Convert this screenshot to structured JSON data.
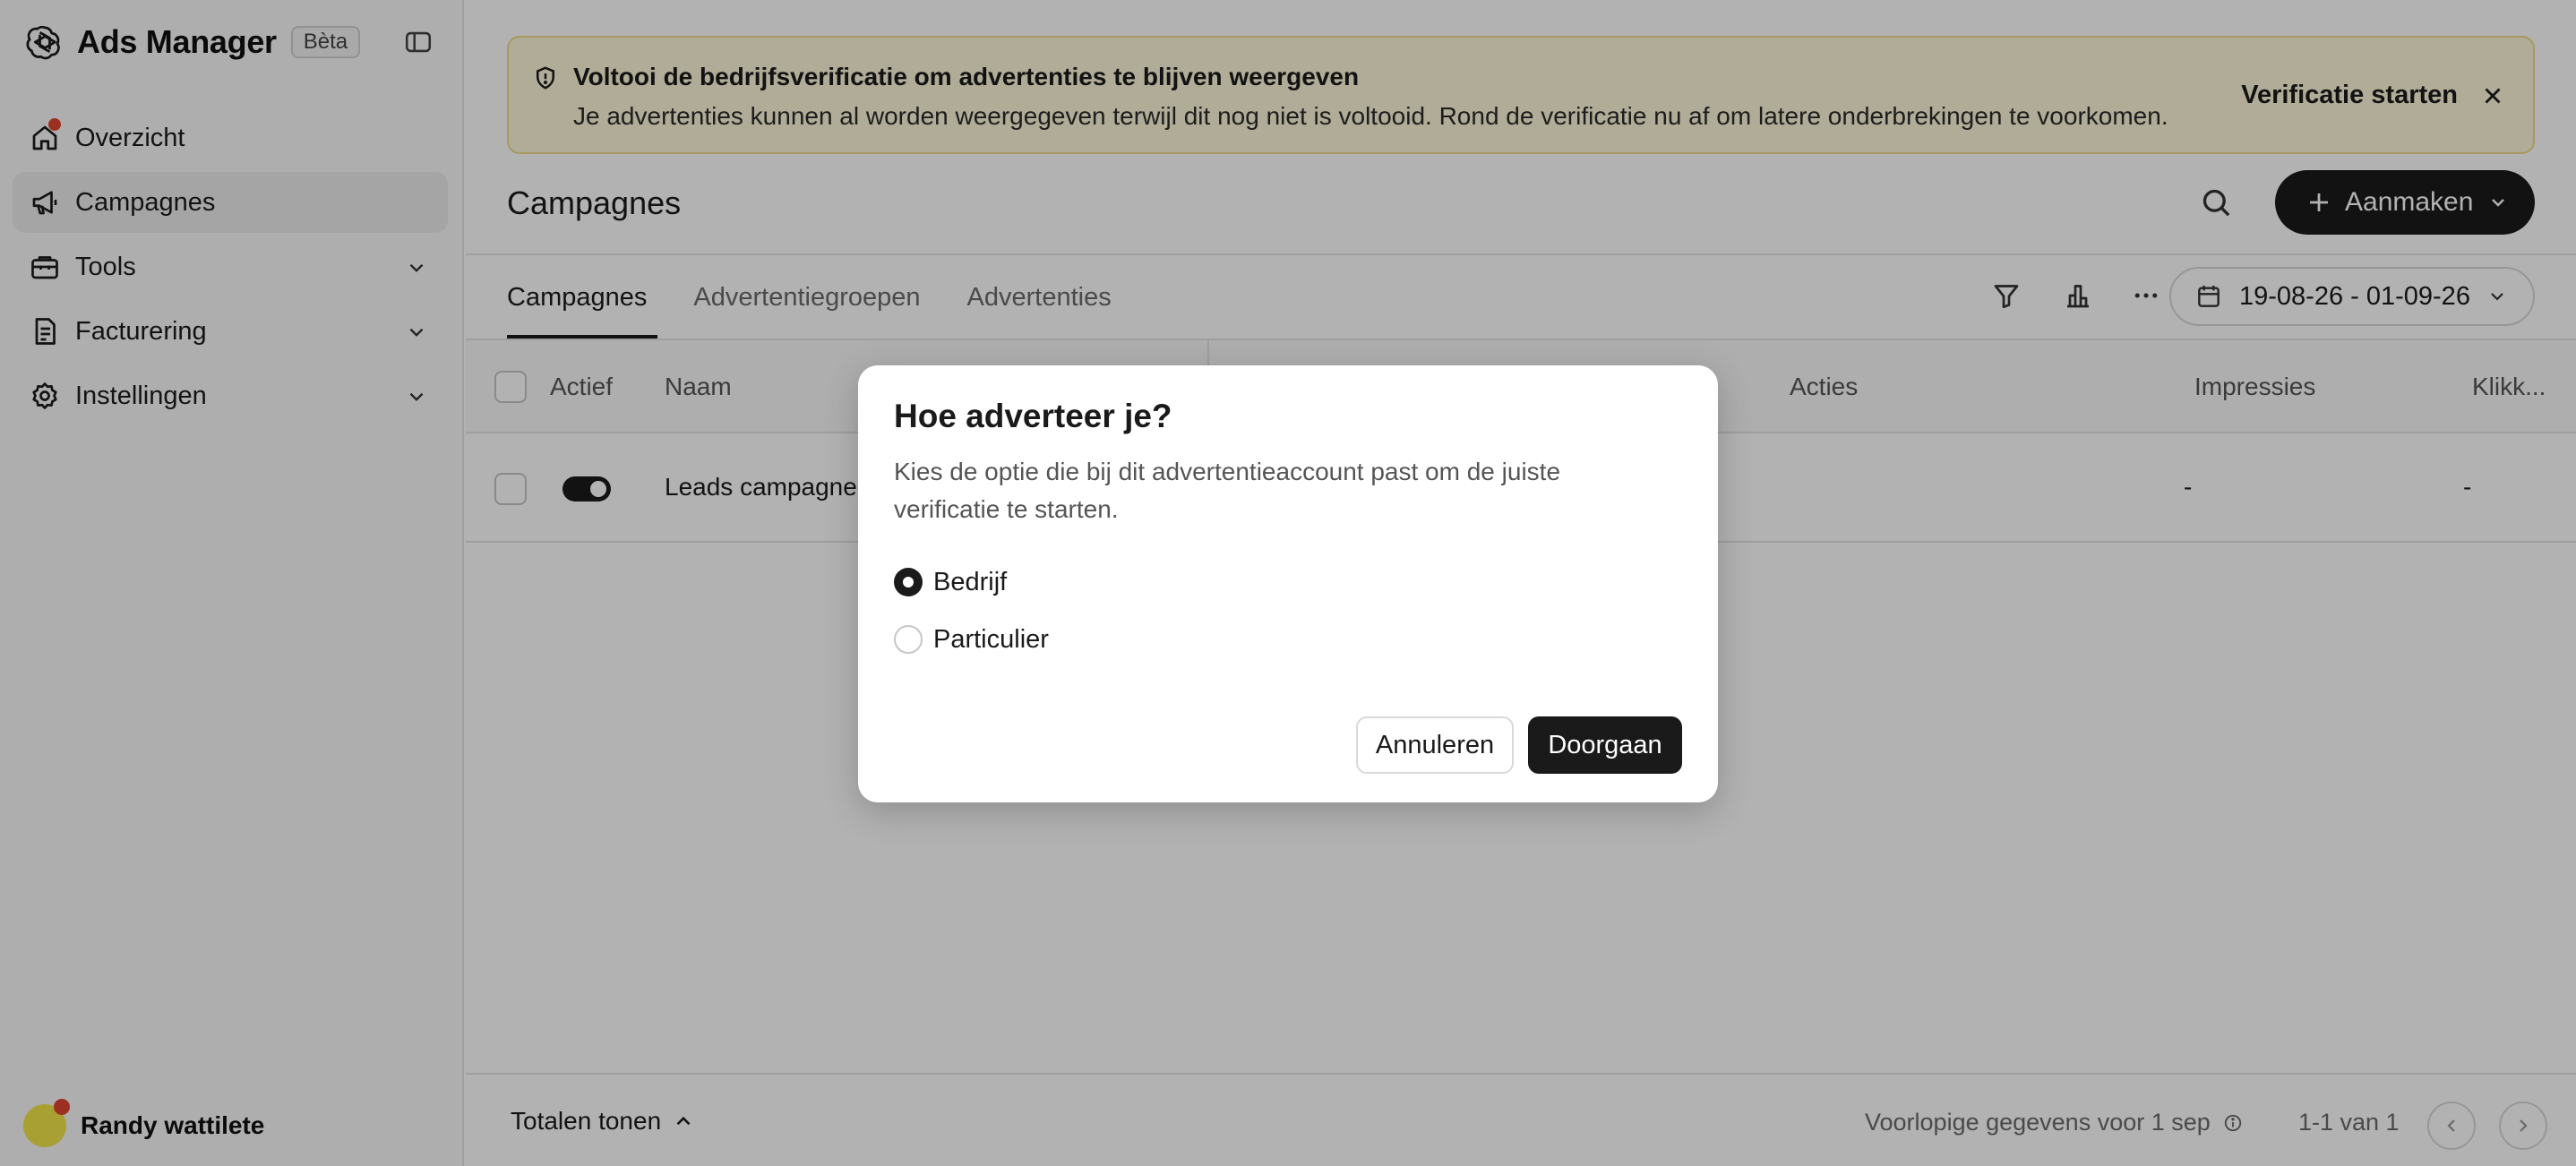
{
  "app": {
    "title": "Ads Manager",
    "badge": "Bèta"
  },
  "sidebar": {
    "items": [
      {
        "label": "Overzicht",
        "icon": "home-icon"
      },
      {
        "label": "Campagnes",
        "icon": "megaphone-icon"
      },
      {
        "label": "Tools",
        "icon": "toolbox-icon"
      },
      {
        "label": "Facturering",
        "icon": "receipt-icon"
      },
      {
        "label": "Instellingen",
        "icon": "gear-icon"
      }
    ],
    "active_item": "Campagnes",
    "user": {
      "name": "Randy wattilete"
    }
  },
  "banner": {
    "title": "Voltooi de bedrijfsverificatie om advertenties te blijven weergeven",
    "text": "Je advertenties kunnen al worden weergegeven terwijl dit nog niet is voltooid. Rond de verificatie nu af om latere onderbrekingen te voorkomen.",
    "action": "Verificatie starten"
  },
  "header": {
    "title": "Campagnes",
    "create_label": "Aanmaken"
  },
  "tabs": [
    {
      "label": "Campagnes",
      "active": true
    },
    {
      "label": "Advertentiegroepen",
      "active": false
    },
    {
      "label": "Advertenties",
      "active": false
    }
  ],
  "toolbar": {
    "date_range": "19-08-26 - 01-09-26"
  },
  "table": {
    "columns": [
      "Actief",
      "Naam",
      "Acties",
      "Impressies",
      "Klikk..."
    ],
    "rows": [
      {
        "active": true,
        "name": "Leads campagne",
        "impressions": "-",
        "clicks": "-"
      }
    ]
  },
  "footer": {
    "totals_label": "Totalen tonen",
    "preliminary": "Voorlopige gegevens voor 1 sep",
    "page_count": "1-1 van 1"
  },
  "dialog": {
    "title": "Hoe adverteer je?",
    "text": "Kies de optie die bij dit advertentieaccount past om de juiste verificatie te starten.",
    "options": [
      {
        "label": "Bedrijf",
        "selected": true
      },
      {
        "label": "Particulier",
        "selected": false
      }
    ],
    "cancel_label": "Annuleren",
    "continue_label": "Doorgaan"
  },
  "colors": {
    "accent": "#1a1a1a",
    "banner_bg": "#fdf6d8",
    "notification": "#e0452f",
    "avatar": "#f2e64b"
  }
}
